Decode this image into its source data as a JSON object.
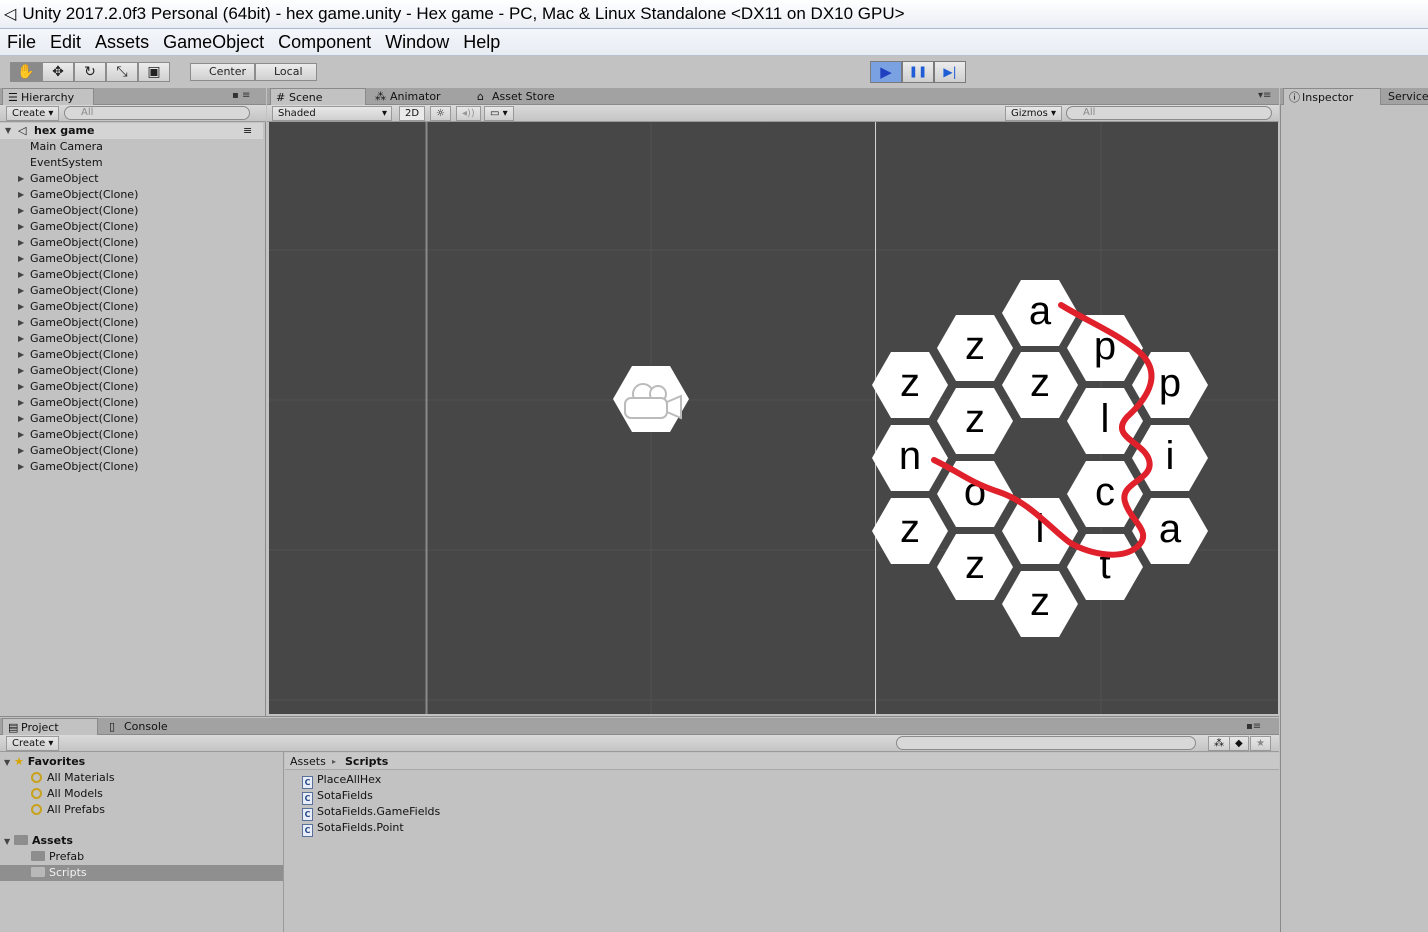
{
  "window": {
    "title": "Unity 2017.2.0f3 Personal (64bit) - hex game.unity - Hex game - PC, Mac & Linux Standalone <DX11 on DX10 GPU>"
  },
  "menu": [
    "File",
    "Edit",
    "Assets",
    "GameObject",
    "Component",
    "Window",
    "Help"
  ],
  "toolbar": {
    "tools": [
      "hand-icon",
      "move-icon",
      "rotate-icon",
      "scale-icon",
      "rect-icon"
    ],
    "pivot": "Center",
    "space": "Local",
    "play": "▶",
    "pause": "❚❚",
    "step": "▶|"
  },
  "hierarchy": {
    "tab": "Hierarchy",
    "create": "Create",
    "search_placeholder": "All",
    "scene_name": "hex game",
    "items": [
      {
        "label": "Main Camera",
        "expandable": false
      },
      {
        "label": "EventSystem",
        "expandable": false
      },
      {
        "label": "GameObject",
        "expandable": true
      },
      {
        "label": "GameObject(Clone)",
        "expandable": true
      },
      {
        "label": "GameObject(Clone)",
        "expandable": true
      },
      {
        "label": "GameObject(Clone)",
        "expandable": true
      },
      {
        "label": "GameObject(Clone)",
        "expandable": true
      },
      {
        "label": "GameObject(Clone)",
        "expandable": true
      },
      {
        "label": "GameObject(Clone)",
        "expandable": true
      },
      {
        "label": "GameObject(Clone)",
        "expandable": true
      },
      {
        "label": "GameObject(Clone)",
        "expandable": true
      },
      {
        "label": "GameObject(Clone)",
        "expandable": true
      },
      {
        "label": "GameObject(Clone)",
        "expandable": true
      },
      {
        "label": "GameObject(Clone)",
        "expandable": true
      },
      {
        "label": "GameObject(Clone)",
        "expandable": true
      },
      {
        "label": "GameObject(Clone)",
        "expandable": true
      },
      {
        "label": "GameObject(Clone)",
        "expandable": true
      },
      {
        "label": "GameObject(Clone)",
        "expandable": true
      },
      {
        "label": "GameObject(Clone)",
        "expandable": true
      },
      {
        "label": "GameObject(Clone)",
        "expandable": true
      },
      {
        "label": "GameObject(Clone)",
        "expandable": true
      }
    ]
  },
  "scene_tabs": [
    "Scene",
    "Animator",
    "Asset Store"
  ],
  "scene_bar": {
    "shading": "Shaded",
    "mode2d": "2D",
    "gizmos": "Gizmos",
    "search_placeholder": "All"
  },
  "inspector_tabs": [
    "Inspector",
    "Services"
  ],
  "hex_letters": [
    "a",
    "z",
    "p",
    "z",
    "z",
    "p",
    "z",
    "l",
    "n",
    "i",
    "o",
    "c",
    "z",
    "l",
    "a",
    "z",
    "t",
    "z"
  ],
  "project": {
    "tabs": [
      "Project",
      "Console"
    ],
    "create": "Create",
    "favorites_label": "Favorites",
    "favorites": [
      "All Materials",
      "All Models",
      "All Prefabs"
    ],
    "assets_label": "Assets",
    "folders": [
      "Prefab",
      "Scripts"
    ],
    "selected_folder": "Scripts",
    "breadcrumb": [
      "Assets",
      "Scripts"
    ],
    "files": [
      "PlaceAllHex",
      "SotaFields",
      "SotaFields.GameFields",
      "SotaFields.Point"
    ]
  },
  "colors": {
    "scene_bg": "#474747",
    "stroke": "#e0202a",
    "hex": "#ffffff",
    "panel": "#c2c2c2"
  }
}
